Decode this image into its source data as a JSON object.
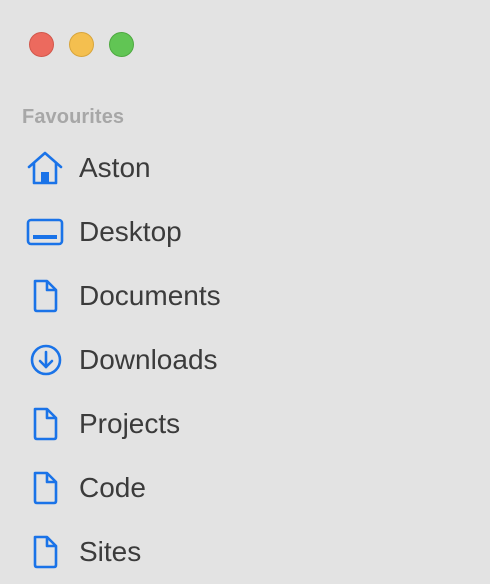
{
  "window": {
    "controls": [
      "close",
      "minimize",
      "zoom"
    ]
  },
  "sidebar": {
    "section_title": "Favourites",
    "items": [
      {
        "label": "Aston",
        "icon": "home-icon"
      },
      {
        "label": "Desktop",
        "icon": "desktop-icon"
      },
      {
        "label": "Documents",
        "icon": "document-icon"
      },
      {
        "label": "Downloads",
        "icon": "download-icon"
      },
      {
        "label": "Projects",
        "icon": "document-icon"
      },
      {
        "label": "Code",
        "icon": "document-icon"
      },
      {
        "label": "Sites",
        "icon": "document-icon"
      }
    ]
  },
  "colors": {
    "background": "#e3e3e3",
    "accent": "#1a73e8",
    "section_label": "#a7a7a7",
    "item_text": "#3b3b3b",
    "close": "#ec6a5e",
    "minimize": "#f4bf4f",
    "zoom": "#61c554"
  }
}
